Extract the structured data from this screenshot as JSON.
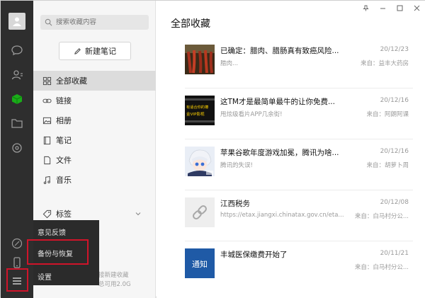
{
  "sidebar": {
    "search_placeholder": "搜索收藏内容",
    "new_note": "新建笔记",
    "nav": [
      {
        "label": "全部收藏",
        "icon": "grid-icon",
        "active": true
      },
      {
        "label": "链接",
        "icon": "link-icon"
      },
      {
        "label": "相册",
        "icon": "image-icon"
      },
      {
        "label": "笔记",
        "icon": "note-icon"
      },
      {
        "label": "文件",
        "icon": "file-icon"
      },
      {
        "label": "音乐",
        "icon": "music-icon"
      }
    ],
    "tags": "标签",
    "storage_line1": "接新建收藏",
    "storage_line2": "总可用2.0G"
  },
  "popup": {
    "items": [
      "意见反馈",
      "备份与恢复",
      "设置"
    ]
  },
  "main": {
    "title": "全部收藏",
    "window_controls": [
      "pin-icon",
      "minimize-icon",
      "maximize-icon",
      "close-icon"
    ],
    "items": [
      {
        "title": "已确定：腊肉、腊肠真有致癌风险...",
        "sub": "腊肉...",
        "date": "20/12/23",
        "source": "来自：益丰大药房",
        "thumb": "meat"
      },
      {
        "title": "这TM才是最简单最牛的让你免费...",
        "sub": "甩炫级看片APP几余街!",
        "date": "20/12/16",
        "source": "来自：阿朗阿课",
        "thumb": "film"
      },
      {
        "title": "苹果谷歌年度游戏加冕，腾讯为啥...",
        "sub": "腾讯的失误!",
        "date": "20/12/16",
        "source": "来自：胡萝卜周",
        "thumb": "anime"
      },
      {
        "title": "江西税务",
        "sub": "https://etax.jiangxi.chinatax.gov.cn/eta...",
        "date": "20/12/08",
        "source": "来自：白马村分公...",
        "thumb": "link"
      },
      {
        "title": "丰城医保缴费开始了",
        "sub": "",
        "date": "20/11/21",
        "source": "来自：白马村分公...",
        "thumb": "notice"
      }
    ],
    "film_thumb_text_1": "有适合你的樽",
    "film_thumb_text_2": "金VIP影视",
    "notice_thumb_text": "通知"
  },
  "colors": {
    "rail": "#2e2e2e",
    "accent_green": "#1aad19",
    "highlight_red": "#d0142a"
  }
}
